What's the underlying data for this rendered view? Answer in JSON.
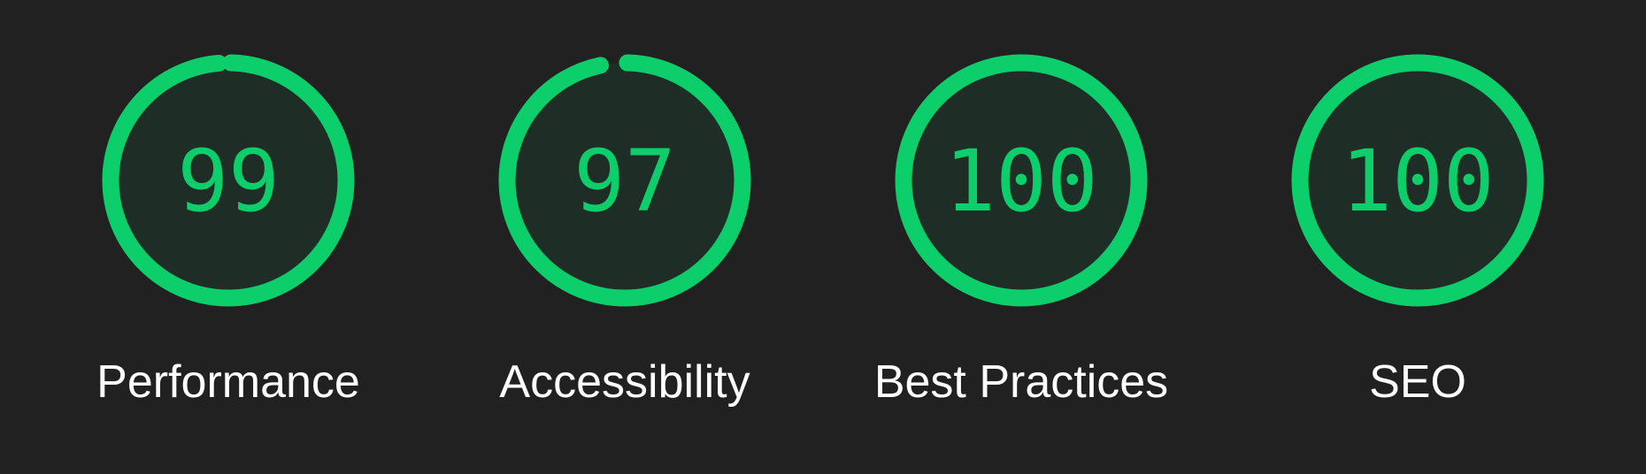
{
  "theme": {
    "background": "#212121",
    "pass_color": "#0cce6b",
    "pass_fill": "#1e2d25",
    "label_color": "#ffffff"
  },
  "gauges": [
    {
      "id": "performance",
      "label": "Performance",
      "score": "99",
      "value": 99,
      "icon": "gauge-ring-icon"
    },
    {
      "id": "accessibility",
      "label": "Accessibility",
      "score": "97",
      "value": 97,
      "icon": "gauge-ring-icon"
    },
    {
      "id": "best-practices",
      "label": "Best Practices",
      "score": "100",
      "value": 100,
      "icon": "gauge-ring-icon"
    },
    {
      "id": "seo",
      "label": "SEO",
      "score": "100",
      "value": 100,
      "icon": "gauge-ring-icon"
    }
  ]
}
